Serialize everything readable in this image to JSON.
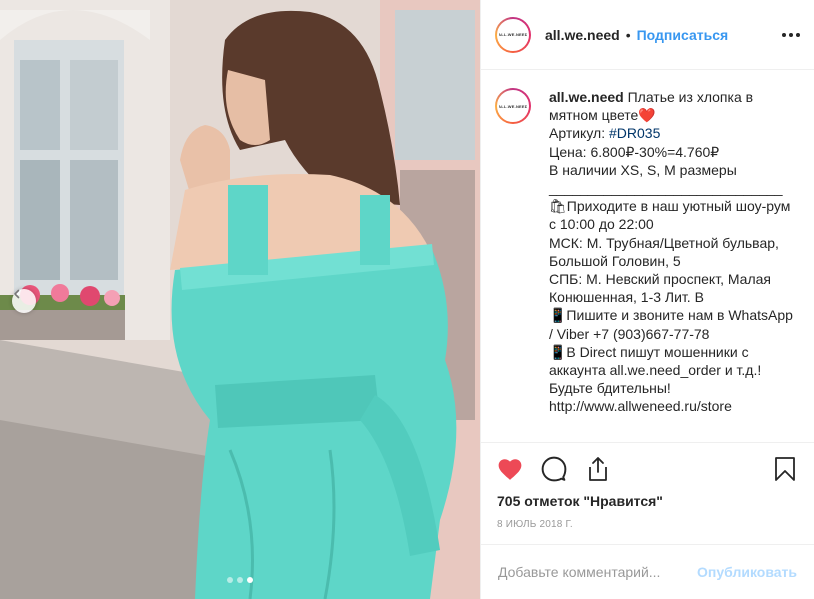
{
  "post": {
    "username": "all.we.need",
    "avatar_text": "ALL.WE.NEED",
    "follow_label": "Подписаться",
    "separator": "•",
    "caption_text": "Платье из хлопка в мятном цвете❤️\nАртикул: ",
    "caption_tag": "#DR035",
    "caption_rest": "\nЦена: 6.800₽-30%=4.760₽\nВ наличии XS, S, M размеры\n______________________________\n🛍Приходите в наш уютный шоу-рум с 10:00 до 22:00\nМСК: М. Трубная/Цветной бульвар, Большой Головин, 5\nСПБ: М. Невский проспект, Малая Конюшенная, 1-3 Лит. В\n📱Пишите и звоните нам в WhatsApp / Viber +7 (903)667-77-78\n📱В Direct пишут мошенники с аккаунта all.we.need_order и т.д.! Будьте бдительны!\nhttp://www.allweneed.ru/store",
    "likes": "705 отметок \"Нравится\"",
    "date": "8 ИЮЛЬ 2018 Г.",
    "comment_placeholder": "Добавьте комментарий...",
    "publish_label": "Опубликовать"
  },
  "icons": {
    "like": "heart-icon",
    "comment": "comment-icon",
    "share": "share-icon",
    "save": "bookmark-icon",
    "more": "more-icon",
    "prev": "chevron-left-icon"
  },
  "carousel": {
    "count": 3,
    "active": 3
  },
  "colors": {
    "like": "#ed4956",
    "follow": "#3897f0",
    "hashtag": "#003569",
    "publish_disabled": "#b3dbff",
    "dress": "#5ed6c8"
  }
}
